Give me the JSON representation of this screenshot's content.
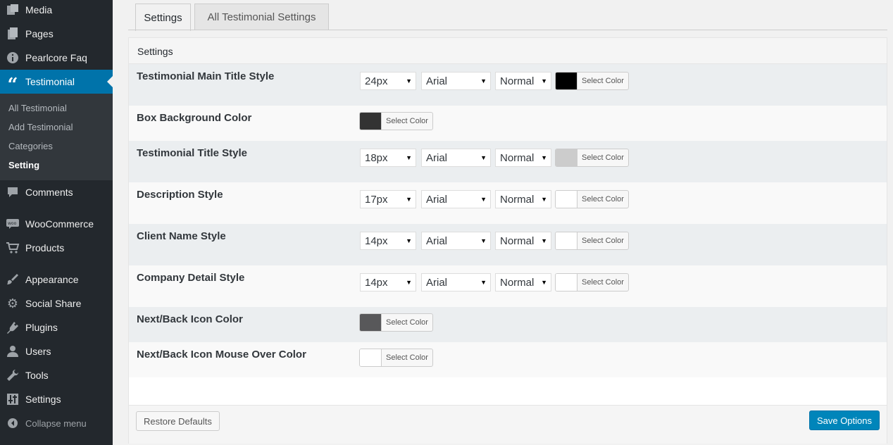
{
  "sidebar": {
    "items": [
      {
        "label": "Media",
        "icon": "media-icon"
      },
      {
        "label": "Pages",
        "icon": "pages-icon"
      },
      {
        "label": "Pearlcore Faq",
        "icon": "info-icon"
      },
      {
        "label": "Testimonial",
        "icon": "quote-icon",
        "active": true
      },
      {
        "label": "Comments",
        "icon": "comment-icon"
      },
      {
        "label": "WooCommerce",
        "icon": "woocommerce-icon"
      },
      {
        "label": "Products",
        "icon": "cart-icon"
      },
      {
        "label": "Appearance",
        "icon": "brush-icon"
      },
      {
        "label": "Social Share",
        "icon": "gear-icon"
      },
      {
        "label": "Plugins",
        "icon": "plugin-icon"
      },
      {
        "label": "Users",
        "icon": "user-icon"
      },
      {
        "label": "Tools",
        "icon": "wrench-icon"
      },
      {
        "label": "Settings",
        "icon": "settings-icon"
      }
    ],
    "submenu": [
      "All Testimonial",
      "Add Testimonial",
      "Categories",
      "Setting"
    ],
    "collapse_label": "Collapse menu"
  },
  "tabs": [
    "Settings",
    "All Testimonial Settings"
  ],
  "panel": {
    "heading": "Settings",
    "select_color_label": "Select Color",
    "rows": [
      {
        "label": "Testimonial Main Title Style",
        "size": "24px",
        "font": "Arial",
        "weight": "Normal",
        "color": "#000000"
      },
      {
        "label": "Box Background Color",
        "color": "#333333"
      },
      {
        "label": "Testimonial Title Style",
        "size": "18px",
        "font": "Arial",
        "weight": "Normal",
        "color": "#cccccc"
      },
      {
        "label": "Description Style",
        "size": "17px",
        "font": "Arial",
        "weight": "Normal",
        "color": "#ffffff"
      },
      {
        "label": "Client Name Style",
        "size": "14px",
        "font": "Arial",
        "weight": "Normal",
        "color": "#ffffff"
      },
      {
        "label": "Company Detail Style",
        "size": "14px",
        "font": "Arial",
        "weight": "Normal",
        "color": "#ffffff"
      },
      {
        "label": "Next/Back Icon Color",
        "color": "#58585a"
      },
      {
        "label": "Next/Back Icon Mouse Over Color",
        "color": "#ffffff"
      }
    ]
  },
  "footer": {
    "restore_label": "Restore Defaults",
    "save_label": "Save Options"
  }
}
